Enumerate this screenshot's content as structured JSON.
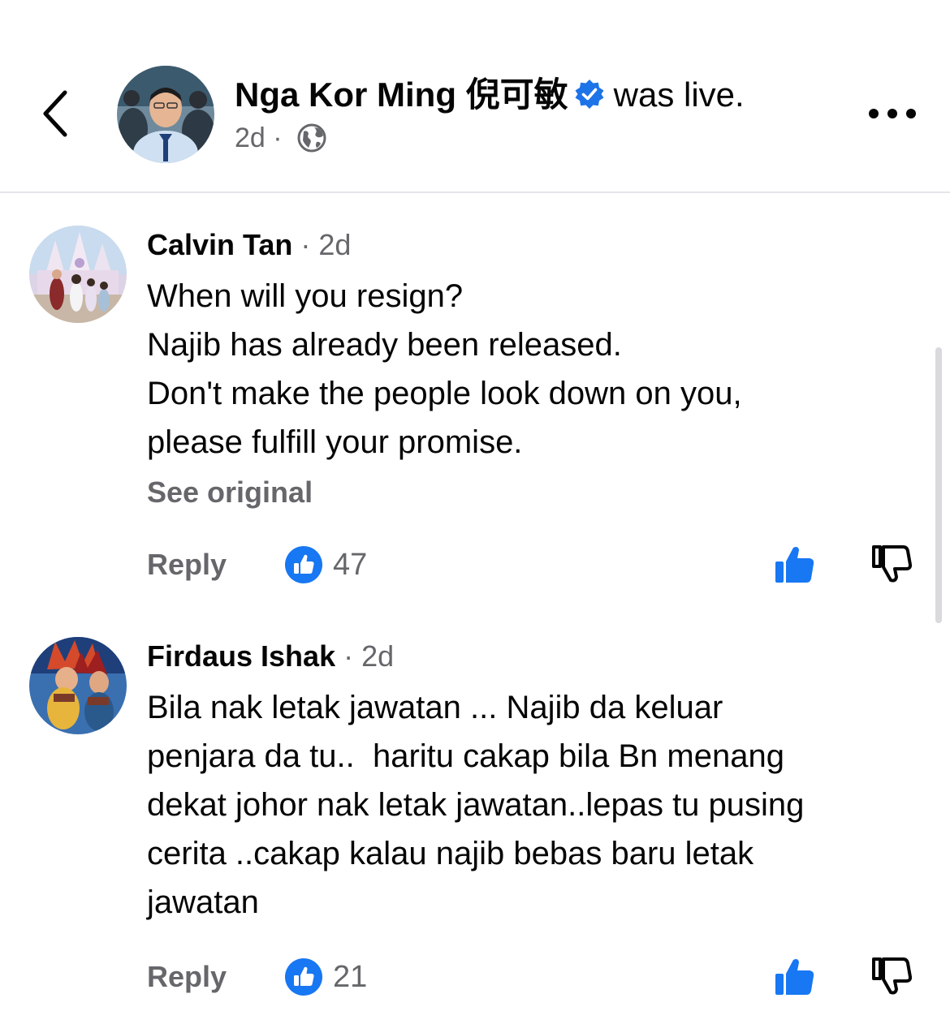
{
  "header": {
    "poster_name": "Nga Kor Ming 倪可敏",
    "action_text": "was live.",
    "time": "2d",
    "separator": "·",
    "icons": {
      "back": "chevron-left-icon",
      "verified": "verified-badge-icon",
      "audience": "globe-icon",
      "more": "more-horizontal-icon"
    }
  },
  "comments": [
    {
      "author": "Calvin Tan",
      "time": "· 2d",
      "text": "When will you resign?\nNajib has already been released.\nDon't make the people look down on you,\nplease fulfill your promise.",
      "see_original": "See original",
      "reply_label": "Reply",
      "like_count": "47"
    },
    {
      "author": "Firdaus Ishak",
      "time": "· 2d",
      "text": "Bila nak letak jawatan ... Najib da keluar\npenjara da tu..  haritu cakap bila Bn menang\ndekat johor nak letak jawatan..lepas tu pusing\ncerita ..cakap kalau najib bebas baru letak\njawatan",
      "reply_label": "Reply",
      "like_count": "21"
    }
  ],
  "colors": {
    "text_primary": "#050505",
    "text_secondary": "#65676b",
    "accent_blue": "#1877f2",
    "verified_blue": "#1d73e8",
    "divider": "#e4e6eb"
  }
}
